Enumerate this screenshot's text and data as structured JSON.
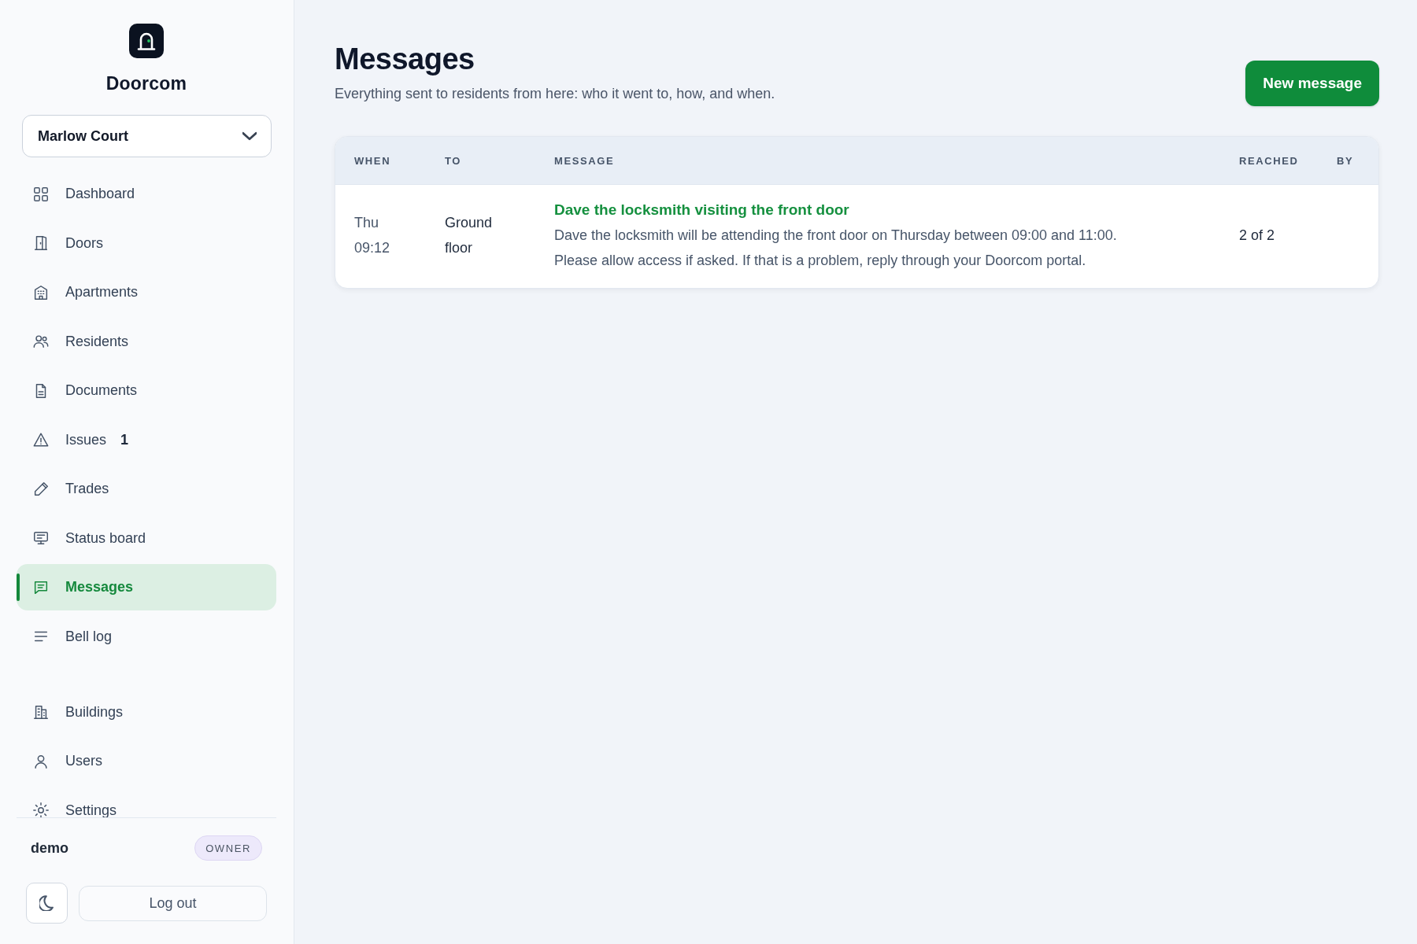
{
  "sidebar": {
    "brand": "Doorcom",
    "building_select": {
      "value": "Marlow Court"
    },
    "nav": [
      {
        "label": "Dashboard",
        "selected": false
      },
      {
        "label": "Doors",
        "selected": false
      },
      {
        "label": "Apartments",
        "selected": false
      },
      {
        "label": "Residents",
        "selected": false
      },
      {
        "label": "Documents",
        "selected": false
      },
      {
        "label": "Issues",
        "count": "1",
        "selected": false
      },
      {
        "label": "Trades",
        "selected": false
      },
      {
        "label": "Status board",
        "selected": false
      },
      {
        "label": "Messages",
        "selected": true
      },
      {
        "label": "Bell log",
        "selected": false
      }
    ],
    "admin_nav": [
      {
        "label": "Buildings",
        "selected": false
      },
      {
        "label": "Users",
        "selected": false
      },
      {
        "label": "Settings",
        "selected": false
      }
    ],
    "user": {
      "name": "demo",
      "role": "OWNER"
    },
    "log_out": "Log out"
  },
  "page": {
    "title": "Messages",
    "subtitle": "Everything sent to residents from here: who it went to, how, and when.",
    "primary_action": "New message"
  },
  "table": {
    "columns": [
      "WHEN",
      "TO",
      "MESSAGE",
      "REACHED",
      "BY"
    ],
    "rows": [
      {
        "when": "Thu 09:12",
        "to": "Ground floor",
        "title": "Dave the locksmith visiting the front door",
        "body": "Dave the locksmith will be attending the front door on Thursday between 09:00 and 11:00.\nPlease allow access if asked. If that is a problem, reply through your Doorcom portal.",
        "reached": "2 of 2"
      }
    ]
  }
}
